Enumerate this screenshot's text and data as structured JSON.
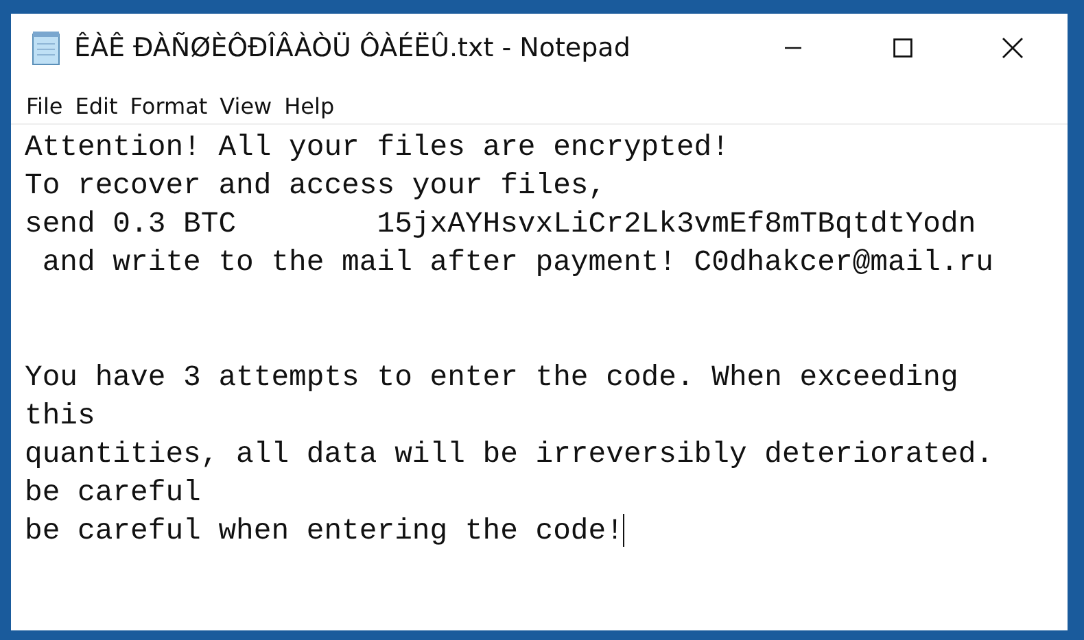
{
  "window": {
    "title": "ÊÀÊ ÐÀÑØÈÔÐÎÂÀÒÜ ÔÀÉËÛ.txt - Notepad"
  },
  "menu": [
    "File",
    "Edit",
    "Format",
    "View",
    "Help"
  ],
  "paragraphs": [
    [
      "Attention! All your files are encrypted!",
      "To recover and access your files,",
      "send 0.3 BTC        15jxAYHsvxLiCr2Lk3vmEf8mTBqtdtYodn",
      " and write to the mail after payment! C0dhakcer@mail.ru"
    ],
    [
      "You have 3 attempts to enter the code. When exceeding",
      "this",
      "quantities, all data will be irreversibly deteriorated.",
      "be careful",
      "be careful when entering the code!"
    ]
  ]
}
